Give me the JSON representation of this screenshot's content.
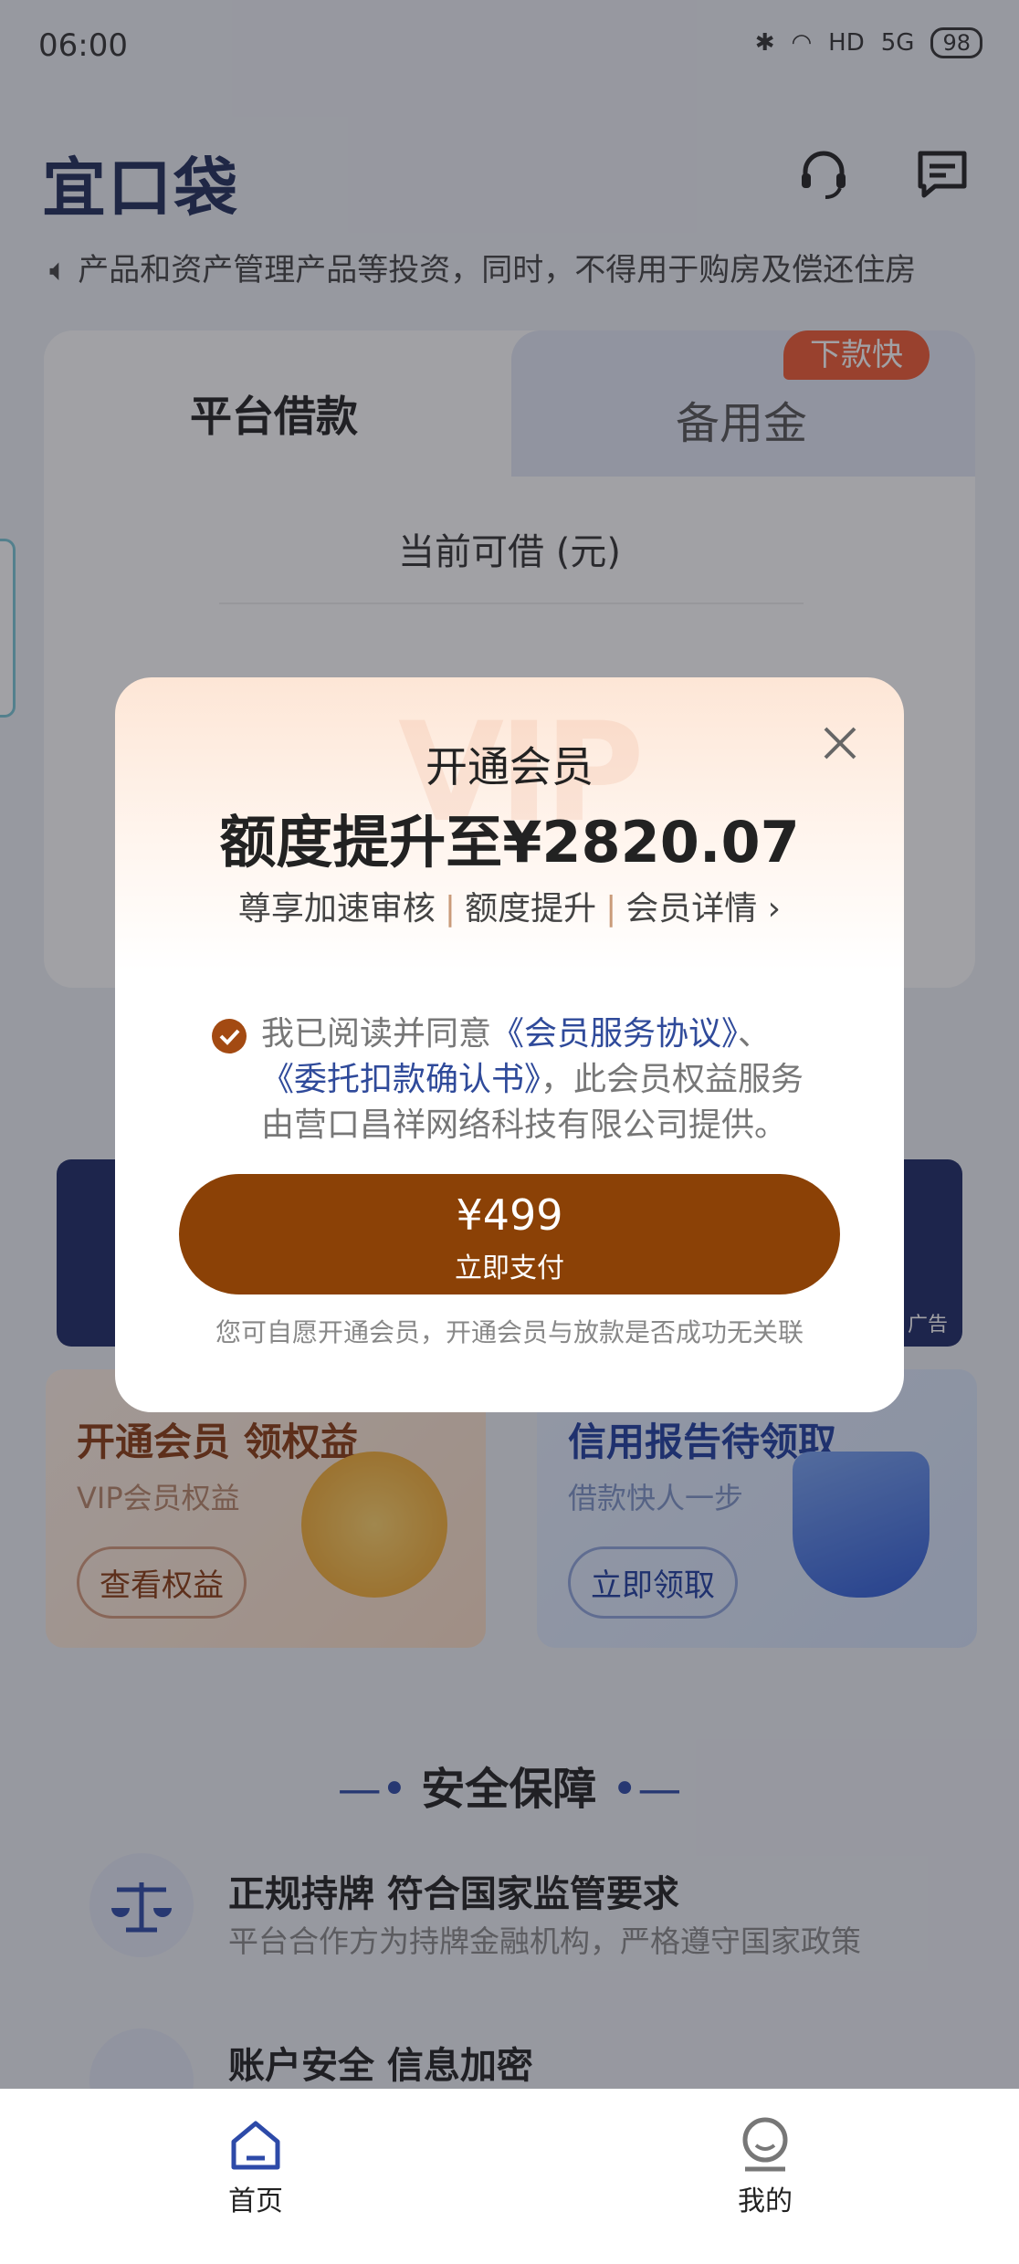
{
  "status_bar": {
    "time": "06:00",
    "network": "5G",
    "hd": "HD",
    "battery": "98"
  },
  "header": {
    "logo": "宜口袋"
  },
  "notice": {
    "text": "产品和资产管理产品等投资，同时，不得用于购房及偿还住房"
  },
  "loan_card": {
    "tab_platform": "平台借款",
    "tab_reserve": "备用金",
    "badge_fast": "下款快",
    "available_label": "当前可借 (元)"
  },
  "banner": {
    "ad_label": "广告"
  },
  "promo_left": {
    "title": "开通会员 领权益",
    "subtitle": "VIP会员权益",
    "button": "查看权益"
  },
  "promo_right": {
    "title": "信用报告待领取",
    "subtitle": "借款快人一步",
    "button": "立即领取"
  },
  "security": {
    "title": "安全保障",
    "items": [
      {
        "title": "正规持牌 符合国家监管要求",
        "subtitle": "平台合作方为持牌金融机构，严格遵守国家政策"
      },
      {
        "title": "账户安全 信息加密",
        "subtitle": ""
      }
    ]
  },
  "tabbar": {
    "home": "首页",
    "mine": "我的"
  },
  "dialog": {
    "watermark": "VIP",
    "small_title": "开通会员",
    "big_title": "额度提升至¥2820.07",
    "features": [
      "尊享加速审核",
      "额度提升",
      "会员详情"
    ],
    "agree_prefix": "我已阅读并同意",
    "agreement1": "《会员服务协议》",
    "agree_sep": "、",
    "agreement2": "《委托扣款确认书》",
    "agree_suffix": "，此会员权益服务由营口昌祥网络科技有限公司提供。",
    "pay_price": "¥499",
    "pay_label": "立即支付",
    "note": "您可自愿开通会员，开通会员与放款是否成功无关联"
  },
  "colors": {
    "accent_brown": "#8b4106",
    "link_blue": "#2f4a9a",
    "badge_orange": "#f15a32"
  }
}
